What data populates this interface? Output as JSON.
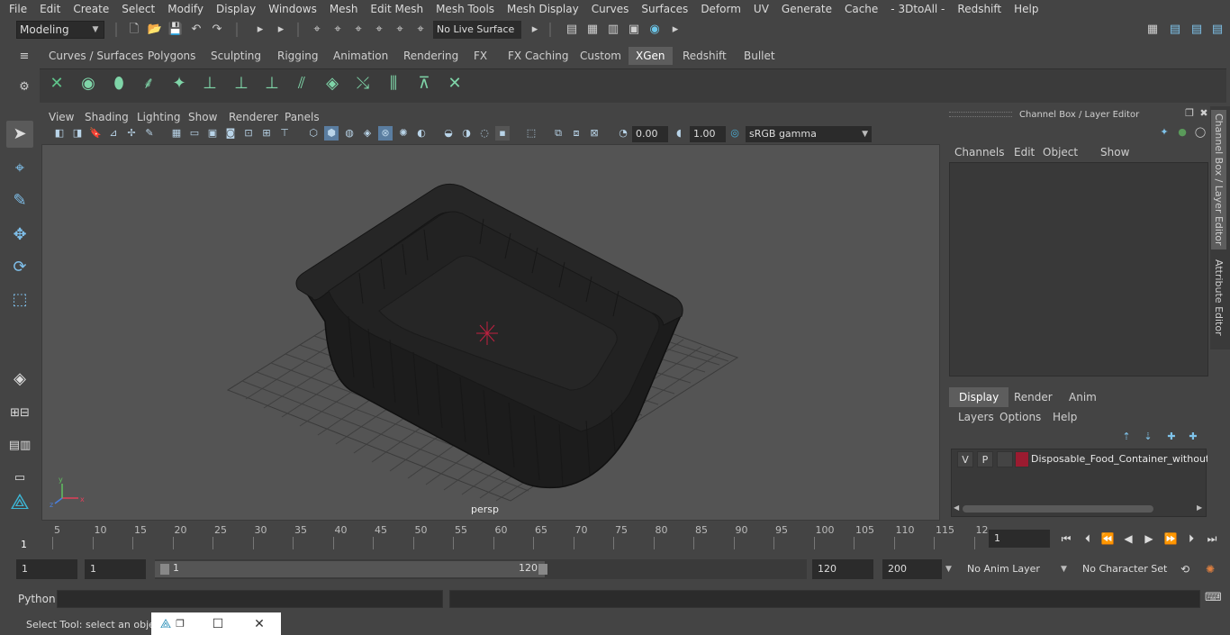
{
  "menubar": [
    "File",
    "Edit",
    "Create",
    "Select",
    "Modify",
    "Display",
    "Windows",
    "Mesh",
    "Edit Mesh",
    "Mesh Tools",
    "Mesh Display",
    "Curves",
    "Surfaces",
    "Deform",
    "UV",
    "Generate",
    "Cache",
    "- 3DtoAll -",
    "Redshift",
    "Help"
  ],
  "status": {
    "mode": "Modeling",
    "live_surface": "No Live Surface"
  },
  "shelf_tabs": [
    "Curves / Surfaces",
    "Polygons",
    "Sculpting",
    "Rigging",
    "Animation",
    "Rendering",
    "FX",
    "FX Caching",
    "Custom",
    "XGen",
    "Redshift",
    "Bullet"
  ],
  "shelf_active": "XGen",
  "panel_menus": [
    "View",
    "Shading",
    "Lighting",
    "Show",
    "Renderer",
    "Panels"
  ],
  "viewport": {
    "exposure": "0.00",
    "gamma": "1.00",
    "color_space": "sRGB gamma",
    "camera": "persp"
  },
  "channel_box": {
    "title": "Channel Box / Layer Editor",
    "menus": [
      "Channels",
      "Edit",
      "Object",
      "Show"
    ]
  },
  "layer_editor": {
    "tabs": [
      "Display",
      "Render",
      "Anim"
    ],
    "active_tab": "Display",
    "menus": [
      "Layers",
      "Options",
      "Help"
    ],
    "layer": {
      "v": "V",
      "p": "P",
      "color": "#9b1b30",
      "name": "Disposable_Food_Container_without"
    }
  },
  "side_tabs": [
    "Channel Box / Layer Editor",
    "Attribute Editor"
  ],
  "timeline": {
    "ticks": [
      "5",
      "10",
      "15",
      "20",
      "25",
      "30",
      "35",
      "40",
      "45",
      "50",
      "55",
      "60",
      "65",
      "70",
      "75",
      "80",
      "85",
      "90",
      "95",
      "100",
      "105",
      "110",
      "115",
      "12"
    ],
    "start_tick": "1",
    "current_frame": "1"
  },
  "range": {
    "start": "1",
    "playback_start": "1",
    "slider_start": "1",
    "slider_end": "120",
    "playback_end": "120",
    "end": "200",
    "anim_layer": "No Anim Layer",
    "character_set": "No Character Set"
  },
  "cmdline": {
    "label": "Python"
  },
  "helpline": {
    "text": "Select Tool: select an object"
  }
}
